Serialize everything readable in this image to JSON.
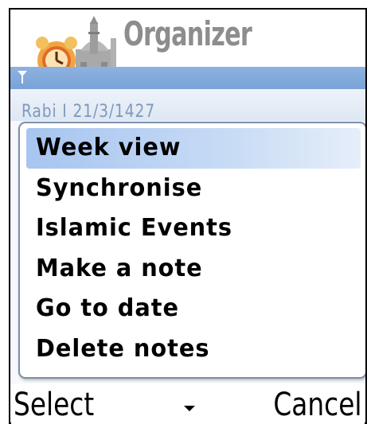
{
  "header": {
    "title": "Organizer",
    "icon": "organizer-alarm-clock-mosque-icon"
  },
  "status": {
    "signal_icon": "signal-antenna-icon"
  },
  "date_strip": {
    "text": "Rabi I 21/3/1427"
  },
  "menu": {
    "items": [
      {
        "label": "Week view",
        "selected": true
      },
      {
        "label": "Synchronise",
        "selected": false
      },
      {
        "label": "Islamic Events",
        "selected": false
      },
      {
        "label": "Make a note",
        "selected": false
      },
      {
        "label": "Go to date",
        "selected": false
      },
      {
        "label": "Delete notes",
        "selected": false
      }
    ]
  },
  "softkeys": {
    "left": "Select",
    "right": "Cancel",
    "center_icon": "scroll-down-arrow-icon"
  },
  "colors": {
    "signal_bar": "#7aa2d8",
    "selection_highlight": "#a7c5f0",
    "title_gray": "#8d8d8d",
    "date_text": "#7f99bd"
  }
}
